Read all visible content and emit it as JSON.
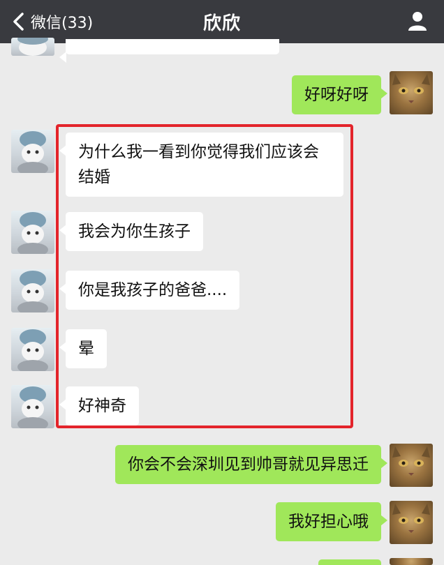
{
  "header": {
    "back_label": "微信(33)",
    "title": "欣欣",
    "background": "#393a3f"
  },
  "icons": {
    "back": "chevron-left-icon",
    "profile": "person-icon"
  },
  "colors": {
    "sent_bubble": "#a0e75a",
    "received_bubble": "#ffffff",
    "highlight": "#e3242b",
    "chat_background": "#ebebeb"
  },
  "messages": [
    {
      "from": "me",
      "text": "好呀好呀"
    },
    {
      "from": "them",
      "text": "为什么我一看到你觉得我们应该会结婚"
    },
    {
      "from": "them",
      "text": "我会为你生孩子"
    },
    {
      "from": "them",
      "text": "你是我孩子的爸爸...."
    },
    {
      "from": "them",
      "text": "晕"
    },
    {
      "from": "them",
      "text": "好神奇"
    },
    {
      "from": "me",
      "text": "你会不会深圳见到帅哥就见异思迁"
    },
    {
      "from": "me",
      "text": "我好担心哦"
    }
  ]
}
